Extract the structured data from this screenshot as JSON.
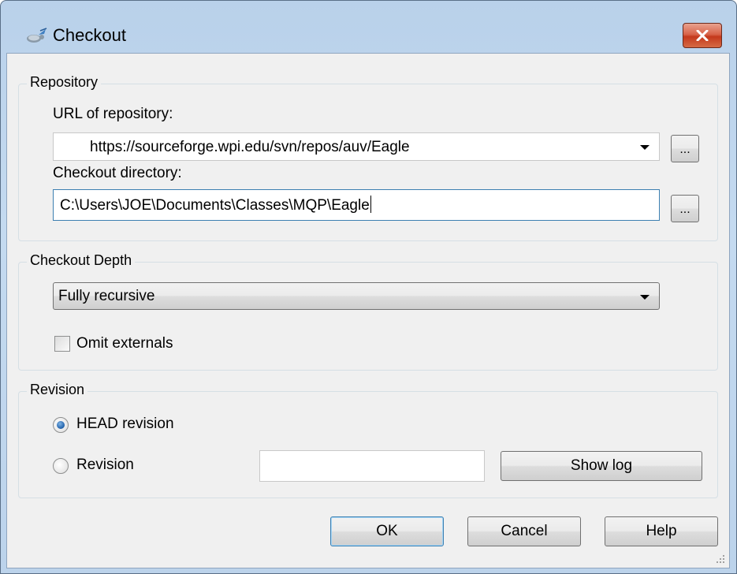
{
  "window": {
    "title": "Checkout",
    "icon": "tortoise-svn-checkout-icon",
    "close_icon": "close-icon"
  },
  "repository": {
    "group_label": "Repository",
    "url_label": "URL of repository:",
    "url_value": "https://sourceforge.wpi.edu/svn/repos/auv/Eagle",
    "dir_label": "Checkout directory:",
    "dir_value": "C:\\Users\\JOE\\Documents\\Classes\\MQP\\Eagle",
    "browse_label": "..."
  },
  "depth": {
    "group_label": "Checkout Depth",
    "selected": "Fully recursive",
    "omit_externals_label": "Omit externals",
    "omit_externals_checked": false
  },
  "revision": {
    "group_label": "Revision",
    "head_label": "HEAD revision",
    "head_selected": true,
    "revision_label": "Revision",
    "revision_value": "",
    "show_log_label": "Show log"
  },
  "buttons": {
    "ok": "OK",
    "cancel": "Cancel",
    "help": "Help"
  },
  "colors": {
    "title_bar": "#b9d1ea",
    "dialog_bg": "#f0f0f0",
    "close_button": "#c4391c",
    "focus_border": "#3c7fb1"
  }
}
